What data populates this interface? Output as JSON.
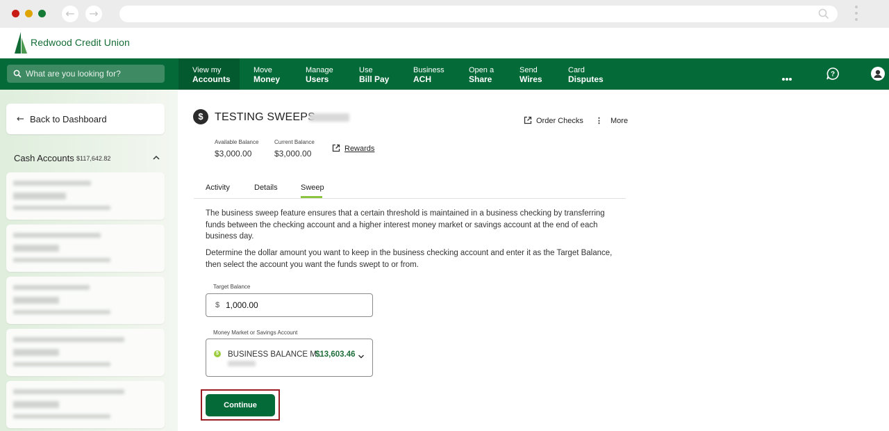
{
  "browser": {
    "back_icon": "arrow-left-icon",
    "forward_icon": "arrow-right-icon",
    "search_icon": "search-icon"
  },
  "brand": {
    "name": "Redwood Credit Union",
    "color": "#046a38"
  },
  "nav": {
    "search_placeholder": "What are you looking for?",
    "items": [
      {
        "line1": "View my",
        "line2": "Accounts"
      },
      {
        "line1": "Move",
        "line2": "Money"
      },
      {
        "line1": "Manage",
        "line2": "Users"
      },
      {
        "line1": "Use",
        "line2": "Bill Pay"
      },
      {
        "line1": "Business",
        "line2": "ACH"
      },
      {
        "line1": "Open a",
        "line2": "Share"
      },
      {
        "line1": "Send",
        "line2": "Wires"
      },
      {
        "line1": "Card",
        "line2": "Disputes"
      }
    ]
  },
  "sidebar": {
    "back_label": "Back to Dashboard",
    "cash_accounts_label": "Cash Accounts",
    "cash_accounts_total": "$117,642.82"
  },
  "account": {
    "title": "TESTING SWEEPS",
    "order_checks": "Order Checks",
    "more": "More",
    "available_balance_label": "Available Balance",
    "available_balance": "$3,000.00",
    "current_balance_label": "Current Balance",
    "current_balance": "$3,000.00",
    "rewards": "Rewards"
  },
  "tabs": [
    {
      "label": "Activity"
    },
    {
      "label": "Details"
    },
    {
      "label": "Sweep"
    }
  ],
  "sweep": {
    "para1": "The business sweep feature ensures that a certain threshold is maintained in a business checking by transferring funds between the checking account and a higher interest money market or savings account at the end of each business day.",
    "para2": "Determine the dollar amount you want to keep in the business checking account and enter it as the Target Balance, then select the account you want the funds swept to or from.",
    "target_label": "Target Balance",
    "currency": "$",
    "target_value": "1,000.00",
    "account_label": "Money Market or Savings Account",
    "selected_account_name": "BUSINESS BALANCE M...",
    "selected_account_amount": "$13,603.46",
    "continue_label": "Continue"
  }
}
